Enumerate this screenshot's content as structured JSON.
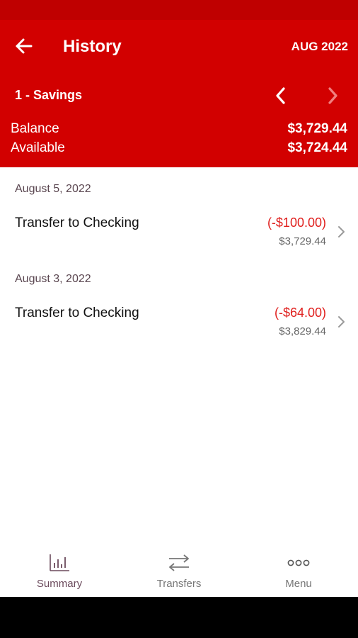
{
  "header": {
    "title": "History",
    "period": "AUG 2022",
    "account": "1 - Savings",
    "balance_label": "Balance",
    "balance_value": "$3,729.44",
    "available_label": "Available",
    "available_value": "$3,724.44",
    "icons": {
      "back": "arrow-left-icon",
      "prev": "chevron-left-icon",
      "next": "chevron-right-icon"
    }
  },
  "groups": [
    {
      "date": "August 5, 2022",
      "transactions": [
        {
          "description": "Transfer to Checking",
          "amount": "(-$100.00)",
          "balance": "$3,729.44"
        }
      ]
    },
    {
      "date": "August 3, 2022",
      "transactions": [
        {
          "description": "Transfer to Checking",
          "amount": "(-$64.00)",
          "balance": "$3,829.44"
        }
      ]
    }
  ],
  "nav": [
    {
      "label": "Summary",
      "icon": "bar-chart-icon"
    },
    {
      "label": "Transfers",
      "icon": "transfer-arrows-icon"
    },
    {
      "label": "Menu",
      "icon": "more-dots-icon"
    }
  ],
  "colors": {
    "brand_red": "#d20000",
    "status_red": "#bf0000",
    "negative_amount": "#e0201e",
    "nav_active": "#6b4a5c",
    "nav_inactive": "#777777"
  }
}
